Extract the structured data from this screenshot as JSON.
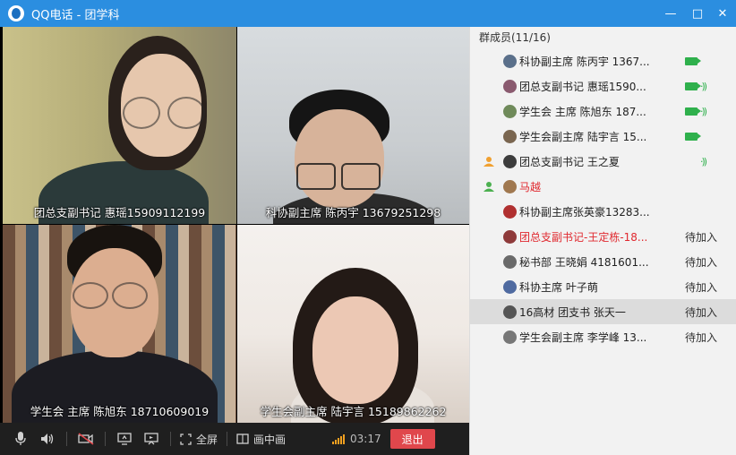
{
  "window": {
    "app_name": "QQ电话",
    "separator": " - ",
    "group_name": "团学科",
    "controls": {
      "minimize": "—",
      "maximize": "□",
      "close": "✕"
    }
  },
  "videos": [
    {
      "caption": "团总支副书记 惠瑶15909112199"
    },
    {
      "caption": "科协副主席 陈丙宇 13679251298"
    },
    {
      "caption": "学生会 主席 陈旭东 18710609019"
    },
    {
      "caption": "学生会副主席 陆宇言 15189862262"
    }
  ],
  "toolbar": {
    "fullscreen_label": "全屏",
    "pip_label": "画中画",
    "timer": "03:17",
    "exit_label": "退出",
    "icons": [
      "microphone-icon",
      "speaker-icon",
      "camera-off-icon",
      "screen-share-icon",
      "slideshow-icon",
      "fullscreen-icon",
      "picture-in-picture-icon",
      "signal-icon"
    ]
  },
  "members_panel": {
    "header": "群成员(11/16)",
    "members": [
      {
        "name": "科协副主席 陈丙宇 1367...",
        "camera": true,
        "speaking": false,
        "status": ""
      },
      {
        "name": "团总支副书记 惠瑶1590...",
        "camera": true,
        "speaking": true,
        "status": ""
      },
      {
        "name": "学生会 主席 陈旭东 187...",
        "camera": true,
        "speaking": true,
        "status": ""
      },
      {
        "name": "学生会副主席 陆宇言 15...",
        "camera": true,
        "speaking": false,
        "status": ""
      },
      {
        "name": "团总支副书记    王之夏",
        "camera": false,
        "speaking": true,
        "status": "",
        "role_icon": true
      },
      {
        "name": "马越",
        "camera": false,
        "speaking": false,
        "status": "",
        "role_icon": true,
        "red": true
      },
      {
        "name": "科协副主席张英豪13283...",
        "camera": false,
        "speaking": false,
        "status": ""
      },
      {
        "name": "团总支副书记-王定栋-18...",
        "camera": false,
        "speaking": false,
        "status": "待加入",
        "red": true
      },
      {
        "name": "秘书部 王晓娟  4181601...",
        "camera": false,
        "speaking": false,
        "status": "待加入"
      },
      {
        "name": "科协主席 叶子萌",
        "camera": false,
        "speaking": false,
        "status": "待加入"
      },
      {
        "name": "16高材   团支书 张天一",
        "camera": false,
        "speaking": false,
        "status": "待加入",
        "selected": true
      },
      {
        "name": "学生会副主席 李学峰 13...",
        "camera": false,
        "speaking": false,
        "status": "待加入"
      }
    ]
  },
  "colors": {
    "titlebar": "#2b8ee0",
    "accent_green": "#2fb04c",
    "exit_red": "#e0474c",
    "highlight_red": "#e0282e"
  }
}
